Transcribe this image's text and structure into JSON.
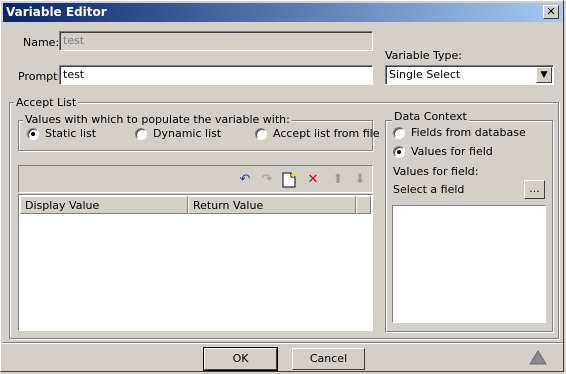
{
  "window": {
    "title": "Variable Editor",
    "close_glyph": "✕"
  },
  "fields": {
    "name_label": "Name:",
    "name_value": "test",
    "prompt_label": "Prompt:",
    "prompt_value": "test",
    "variable_type_label": "Variable Type:",
    "variable_type_value": "Single Select"
  },
  "accept_list": {
    "title": "Accept List",
    "populate_group_title": "Values with which to populate the variable with:",
    "options": [
      "Static list",
      "Dynamic list",
      "Accept list from file"
    ],
    "selected_option": "Static list",
    "toolbar_icons": [
      "undo-icon",
      "redo-icon",
      "new-item-icon",
      "delete-icon",
      "move-up-icon",
      "move-down-icon"
    ],
    "columns": [
      "Display Value",
      "Return Value"
    ]
  },
  "data_context": {
    "title": "Data Context",
    "options": [
      "Fields from database",
      "Values for field"
    ],
    "selected_option": "Values for field",
    "values_for_field_label": "Values for field:",
    "select_field_label": "Select a field",
    "browse_label": "..."
  },
  "buttons": {
    "ok": "OK",
    "cancel": "Cancel"
  }
}
